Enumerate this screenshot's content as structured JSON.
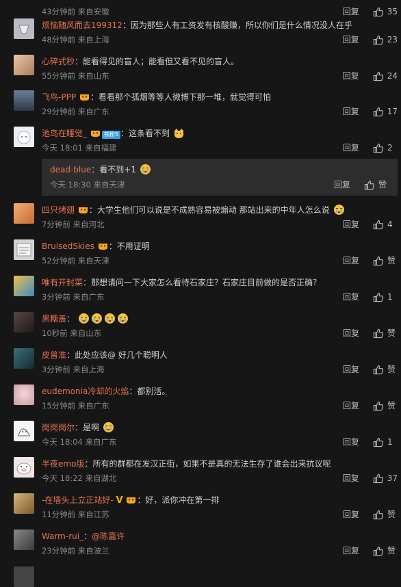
{
  "comments": [
    {
      "user": "",
      "text": "",
      "meta": "43分钟前 来自安徽",
      "reply": "回复",
      "likes": "35",
      "avatar": "#3a3a3a"
    },
    {
      "user": "烦恼随风而去199312",
      "text": "因为那些人有工资发有核酸赚，所以你们是什么情况没人在乎",
      "meta": "48分钟前 来自上海",
      "reply": "回复",
      "likes": "23",
      "avatar": "#b9bcc4"
    },
    {
      "user": "心碎式秒",
      "text": "能看得见的盲人；能看但又看不见的盲人。",
      "meta": "55分钟前 来自山东",
      "reply": "回复",
      "likes": "24",
      "avatar": "#c8a27a"
    },
    {
      "user": "飞鸟-PPP",
      "text": "看看那个孤烟等等人微博下那一堆，就觉得可怕",
      "meta": "29分钟前 来自广东",
      "reply": "回复",
      "likes": "17",
      "avatar": "#4a5a72"
    },
    {
      "user": "池岛在睡觉_",
      "text": "这条看不到",
      "meta": "今天 18:01 来自福建",
      "reply": "回复",
      "likes": "2",
      "avatar": "#e8e8ef",
      "vip_tag": "铁粉5"
    },
    {
      "user": "四只烤翅",
      "text": "大学生他们可以说是不成熟容易被煽动 那站出来的中年人怎么说",
      "meta": "7分钟前 来自河北",
      "reply": "回复",
      "likes": "4",
      "avatar": "#d9975a"
    },
    {
      "user": "BruisedSkies",
      "text": "不用证明",
      "meta": "52分钟前 来自天津",
      "reply": "回复",
      "likes": "赞",
      "avatar": "#cfcfcf"
    },
    {
      "user": "唯有开封菜",
      "text": "那想请问一下大家怎么看待石家庄？石家庄目前做的是否正确？",
      "meta": "3分钟前 来自广东",
      "reply": "回复",
      "likes": "1",
      "avatar": "#d9a23a"
    },
    {
      "user": "黑糖盖",
      "text": "",
      "meta": "10秒前 来自山东",
      "reply": "回复",
      "likes": "赞",
      "avatar": "#3b2f2f"
    },
    {
      "user": "皮普准",
      "text": "此处应该@ 好几个聪明人",
      "meta": "3分钟前 来自上海",
      "reply": "回复",
      "likes": "赞",
      "avatar": "#2b4a5a"
    },
    {
      "user": "eudemonia冷却的火焰",
      "text": "都别活。",
      "meta": "15分钟前 来自广东",
      "reply": "回复",
      "likes": "赞",
      "avatar": "#d8b0b6"
    },
    {
      "user": "岗岗岗尔",
      "text": "是啊",
      "meta": "今天 18:04 来自广东",
      "reply": "回复",
      "likes": "1",
      "avatar": "#f2f2f2"
    },
    {
      "user": "半夜emo版",
      "text": "所有的群都在发汉正街，如果不是真的无法生存了谁会出来抗议呢",
      "meta": "今天 18:22 来自湖北",
      "reply": "回复",
      "likes": "37",
      "avatar": "#e7d8d8"
    },
    {
      "user": "-在墙头上立正站好-",
      "text": "好，派你冲在第一排",
      "meta": "11分钟前 来自江苏",
      "reply": "回复",
      "likes": "赞",
      "avatar": "#b58a4a"
    },
    {
      "user": "Warm-rui_",
      "text": "@陈嘉许",
      "meta": "23分钟前 来自波兰",
      "reply": "回复",
      "likes": "赞",
      "avatar": "#6a6a6a"
    }
  ],
  "subreply": {
    "user": "dead-blue",
    "text": "看不到+1",
    "meta": "今天 18:30 来自天津",
    "reply": "回复",
    "likes": "赞"
  },
  "colors": {
    "background": "#161616",
    "username": "#eb7350",
    "meta": "#8a8a8a",
    "subreply_bg": "#2d2d2d"
  }
}
